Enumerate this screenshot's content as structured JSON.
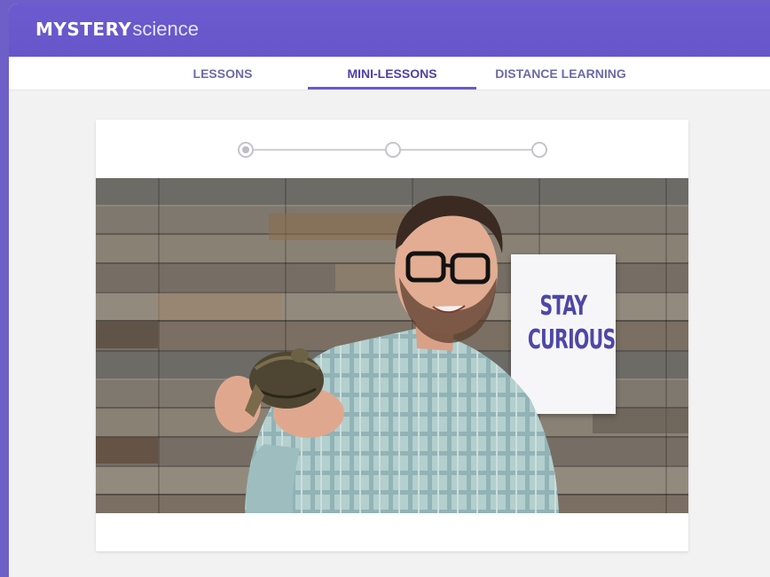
{
  "app": {
    "logo_bold": "MYSTERY",
    "logo_light": "science"
  },
  "nav": {
    "tabs": [
      {
        "label": "LESSONS",
        "active": false
      },
      {
        "label": "MINI-LESSONS",
        "active": true
      },
      {
        "label": "DISTANCE LEARNING",
        "active": false
      }
    ]
  },
  "stepper": {
    "steps": 3,
    "current": 1
  },
  "video": {
    "poster_text": "STAY\nCURIOUS"
  },
  "colors": {
    "brand": "#6a5acd",
    "tab_text": "#6c6aa8",
    "active_tab_text": "#4d3fae",
    "poster_text": "#4d47a8"
  },
  "icons": {
    "step_current": "radio-dot",
    "step": "radio-circle"
  }
}
